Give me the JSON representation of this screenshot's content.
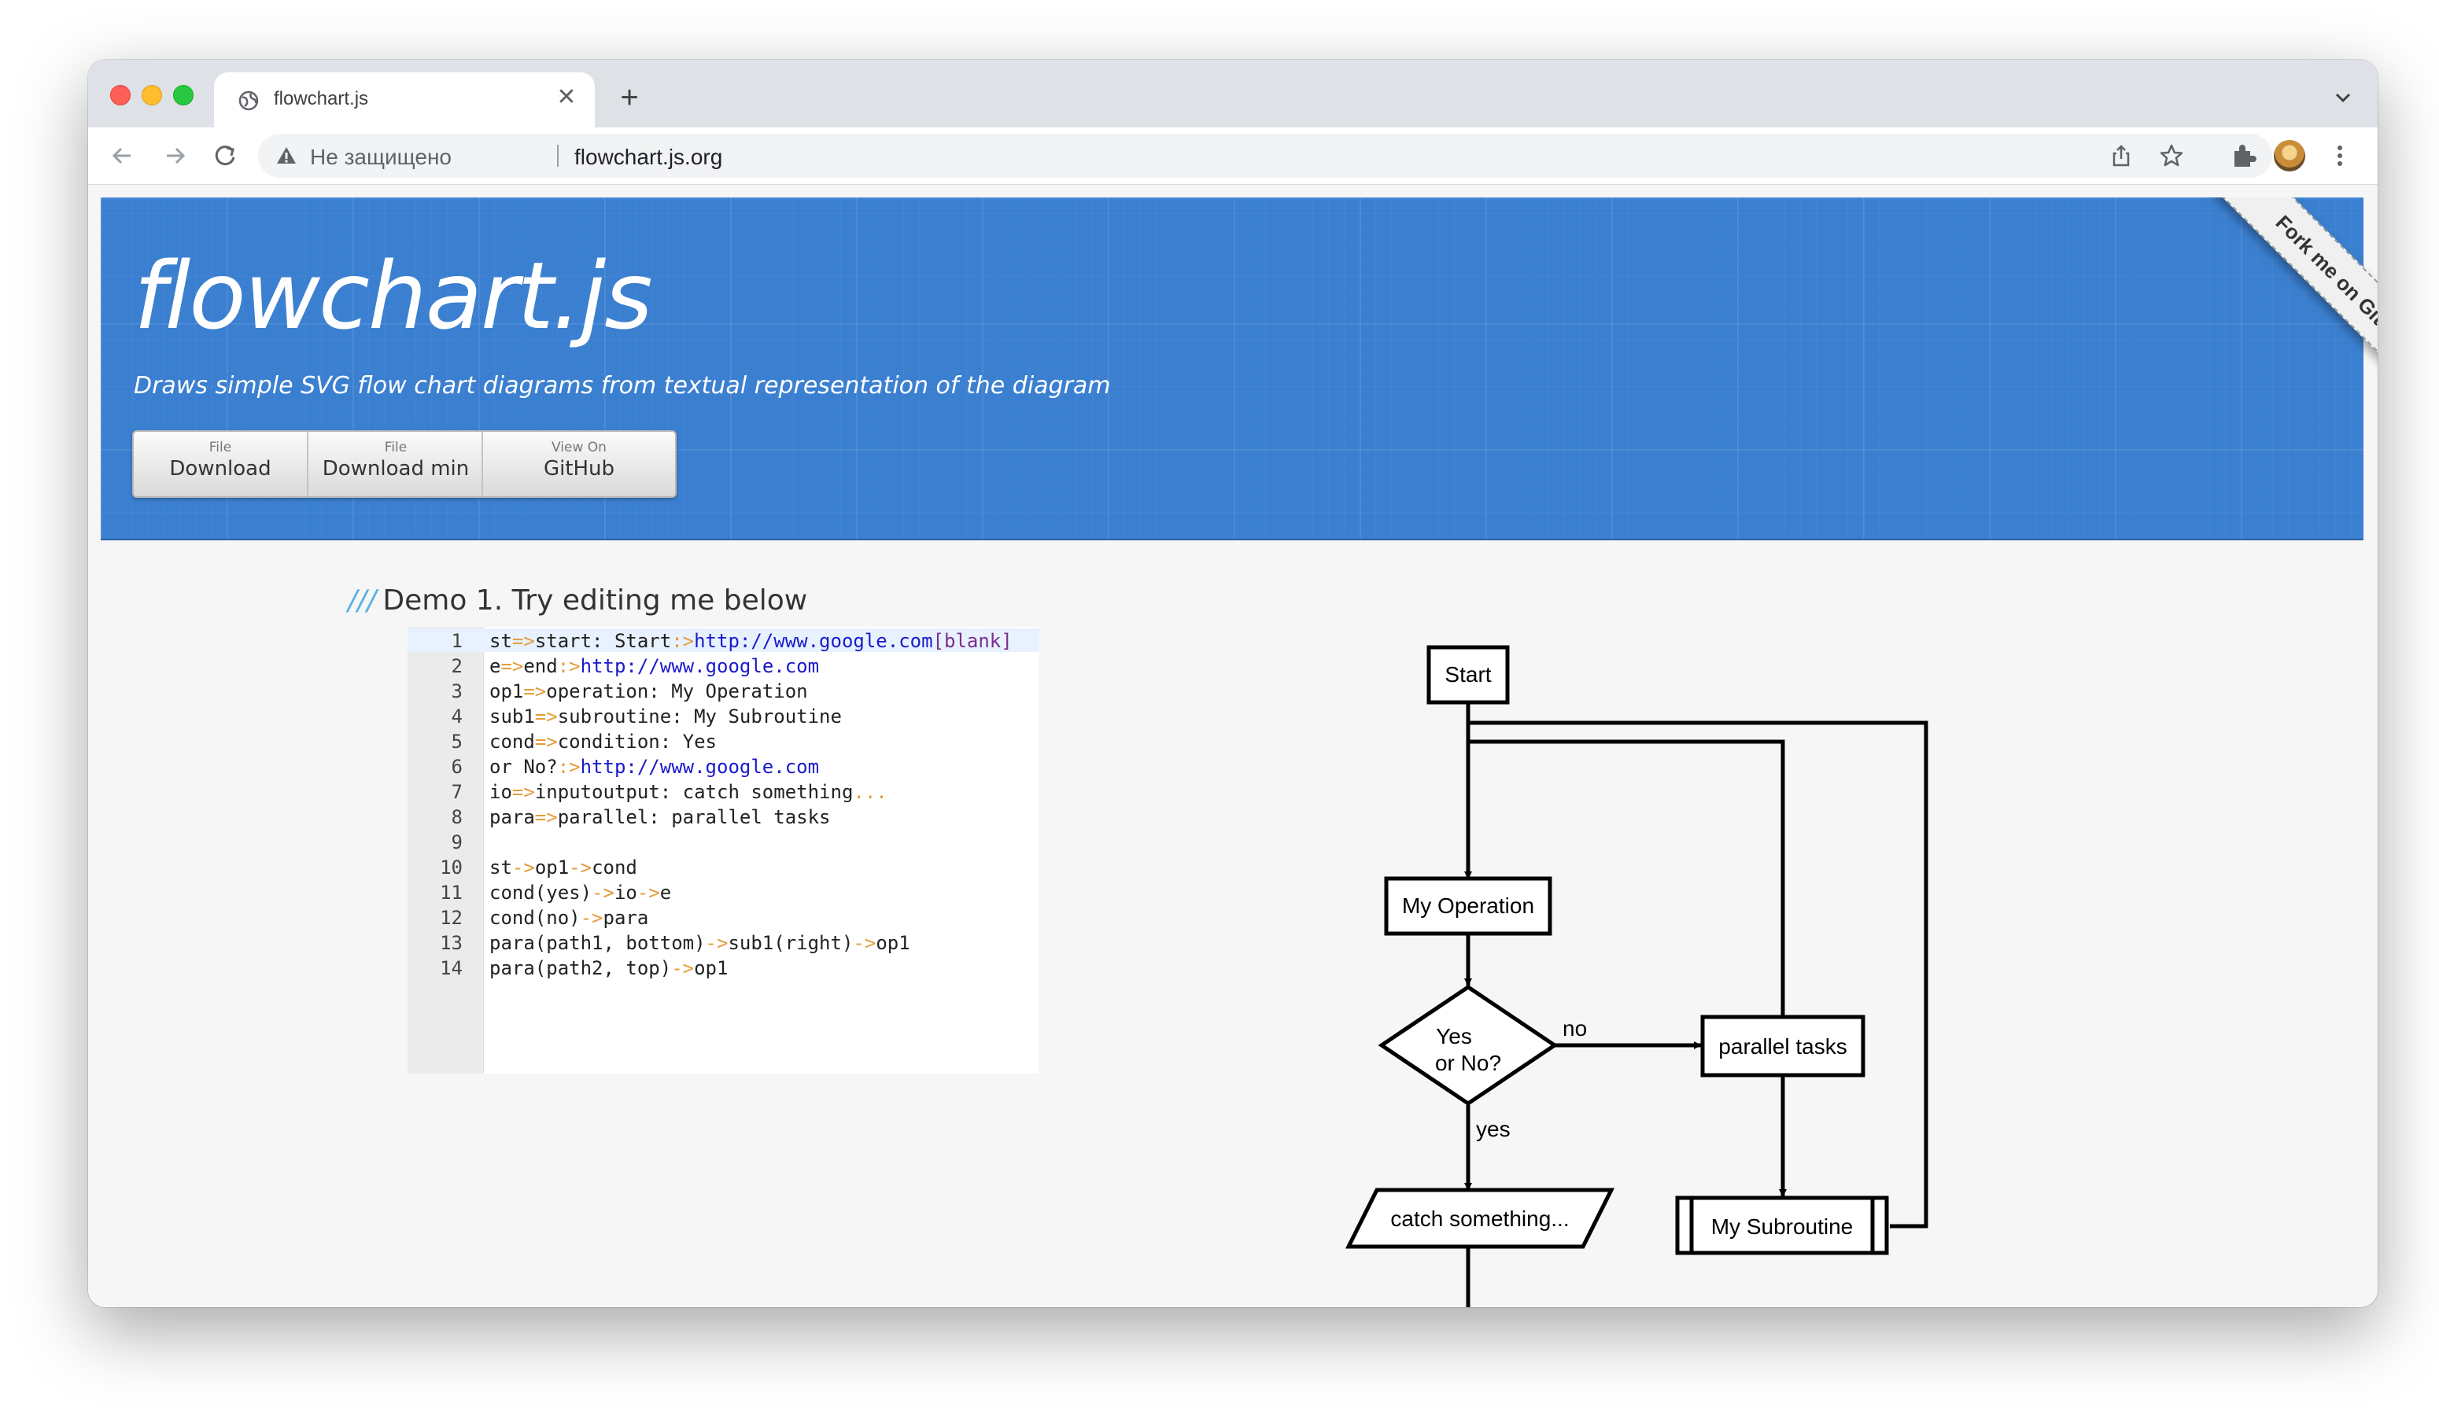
{
  "browser": {
    "tab_title": "flowchart.js",
    "security_label": "Не защищено",
    "url": "flowchart.js.org",
    "new_tab_label": "+",
    "tab_close_label": "✕"
  },
  "header": {
    "logo": "flowchart.js",
    "tagline": "Draws simple SVG flow chart diagrams from textual representation of the diagram",
    "buttons": [
      {
        "small": "File",
        "label": "Download"
      },
      {
        "small": "File",
        "label": "Download min"
      },
      {
        "small": "View On",
        "label": "GitHub"
      }
    ],
    "ribbon": "Fork me on GitHub"
  },
  "demo": {
    "slashes": "///",
    "heading": "Demo 1. Try editing me below"
  },
  "editor": {
    "lines": [
      {
        "n": "1",
        "text": "st=>start: Start:>http://www.google.com[blank]"
      },
      {
        "n": "2",
        "text": "e=>end:>http://www.google.com"
      },
      {
        "n": "3",
        "text": "op1=>operation: My Operation"
      },
      {
        "n": "4",
        "text": "sub1=>subroutine: My Subroutine"
      },
      {
        "n": "5",
        "text": "cond=>condition: Yes"
      },
      {
        "n": "6",
        "text": "or No?:>http://www.google.com"
      },
      {
        "n": "7",
        "text": "io=>inputoutput: catch something..."
      },
      {
        "n": "8",
        "text": "para=>parallel: parallel tasks"
      },
      {
        "n": "9",
        "text": ""
      },
      {
        "n": "10",
        "text": "st->op1->cond"
      },
      {
        "n": "11",
        "text": "cond(yes)->io->e"
      },
      {
        "n": "12",
        "text": "cond(no)->para"
      },
      {
        "n": "13",
        "text": "para(path1, bottom)->sub1(right)->op1"
      },
      {
        "n": "14",
        "text": "para(path2, top)->op1"
      }
    ]
  },
  "flowchart": {
    "start": "Start",
    "operation": "My Operation",
    "condition_line1": "Yes",
    "condition_line2": "or No?",
    "no_label": "no",
    "yes_label": "yes",
    "parallel": "parallel tasks",
    "subroutine": "My Subroutine",
    "inputoutput": "catch something..."
  }
}
